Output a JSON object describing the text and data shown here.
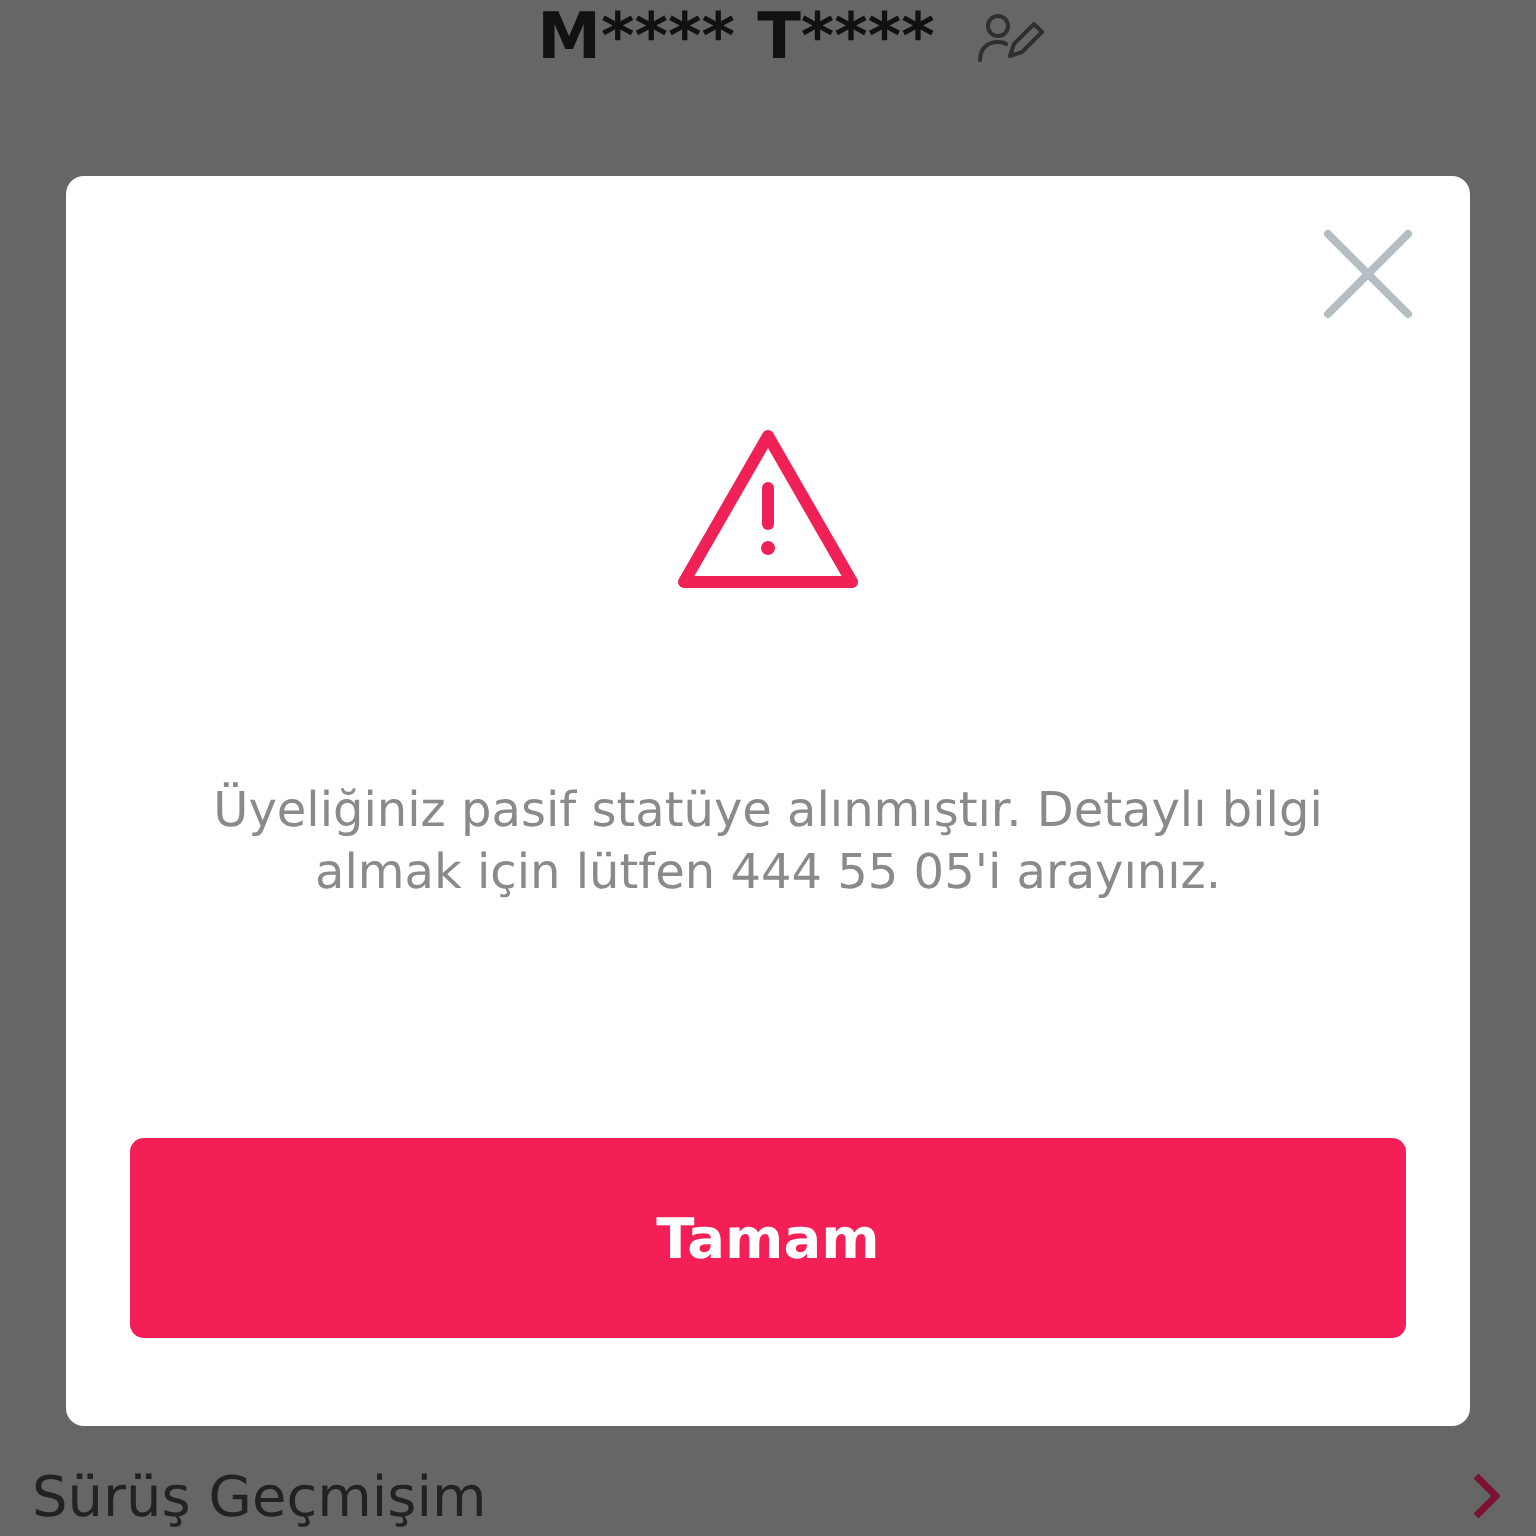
{
  "profile": {
    "name": "M**** T****"
  },
  "menu_items": [
    {
      "label": "Sürüş Geçmişim"
    }
  ],
  "dialog": {
    "message": "Üyeliğiniz pasif statüye alınmıştır. Detaylı bilgi almak için lütfen 444 55 05'i arayınız.",
    "button": "Tamam"
  }
}
